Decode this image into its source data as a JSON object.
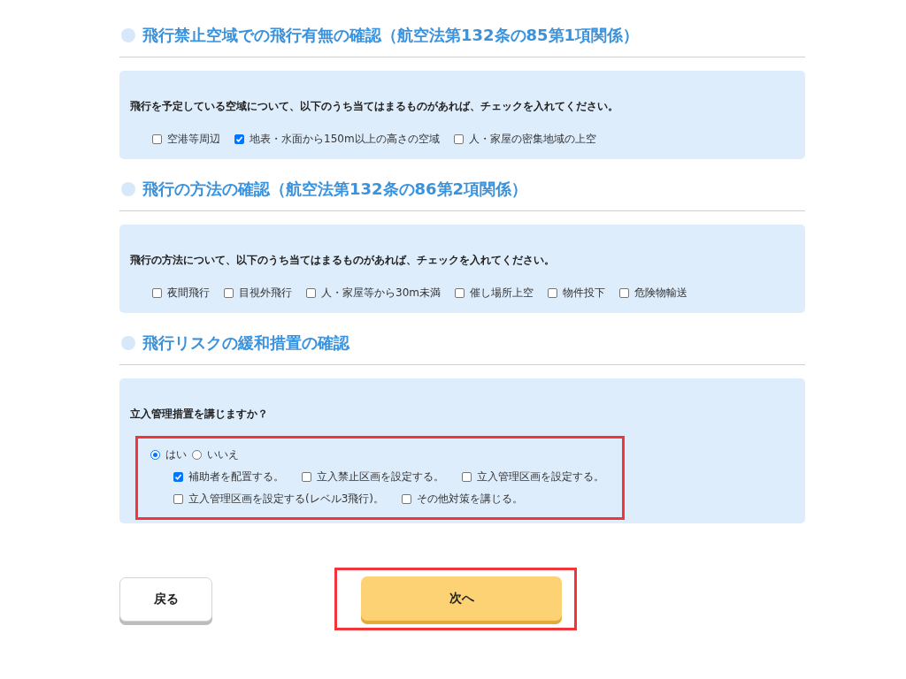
{
  "sections": [
    {
      "kind": "checklist",
      "title": "飛行禁止空域での飛行有無の確認（航空法第132条の85第1項関係）",
      "question": "飛行を予定している空域について、以下のうち当てはまるものがあれば、チェックを入れてください。",
      "options": [
        {
          "label": "空港等周辺",
          "checked": false
        },
        {
          "label": "地表・水面から150m以上の高さの空域",
          "checked": true
        },
        {
          "label": "人・家屋の密集地域の上空",
          "checked": false
        }
      ]
    },
    {
      "kind": "checklist",
      "title": "飛行の方法の確認（航空法第132条の86第2項関係）",
      "question": "飛行の方法について、以下のうち当てはまるものがあれば、チェックを入れてください。",
      "options": [
        {
          "label": "夜間飛行",
          "checked": false
        },
        {
          "label": "目視外飛行",
          "checked": false
        },
        {
          "label": "人・家屋等から30m未満",
          "checked": false
        },
        {
          "label": "催し場所上空",
          "checked": false
        },
        {
          "label": "物件投下",
          "checked": false
        },
        {
          "label": "危険物輸送",
          "checked": false
        }
      ]
    },
    {
      "kind": "measures",
      "title": "飛行リスクの緩和措置の確認",
      "question": "立入管理措置を講じますか？",
      "highlighted": true,
      "radios": [
        {
          "label": "はい",
          "selected": true
        },
        {
          "label": "いいえ",
          "selected": false
        }
      ],
      "option_rows": [
        [
          {
            "label": "補助者を配置する。",
            "checked": true
          },
          {
            "label": "立入禁止区画を設定する。",
            "checked": false
          },
          {
            "label": "立入管理区画を設定する。",
            "checked": false
          }
        ],
        [
          {
            "label": "立入管理区画を設定する(レベル3飛行)。",
            "checked": false
          },
          {
            "label": "その他対策を講じる。",
            "checked": false
          }
        ]
      ]
    }
  ],
  "buttons": [
    {
      "kind": "back",
      "label": "戻る",
      "highlighted": false
    },
    {
      "kind": "next",
      "label": "次へ",
      "highlighted": true
    }
  ]
}
